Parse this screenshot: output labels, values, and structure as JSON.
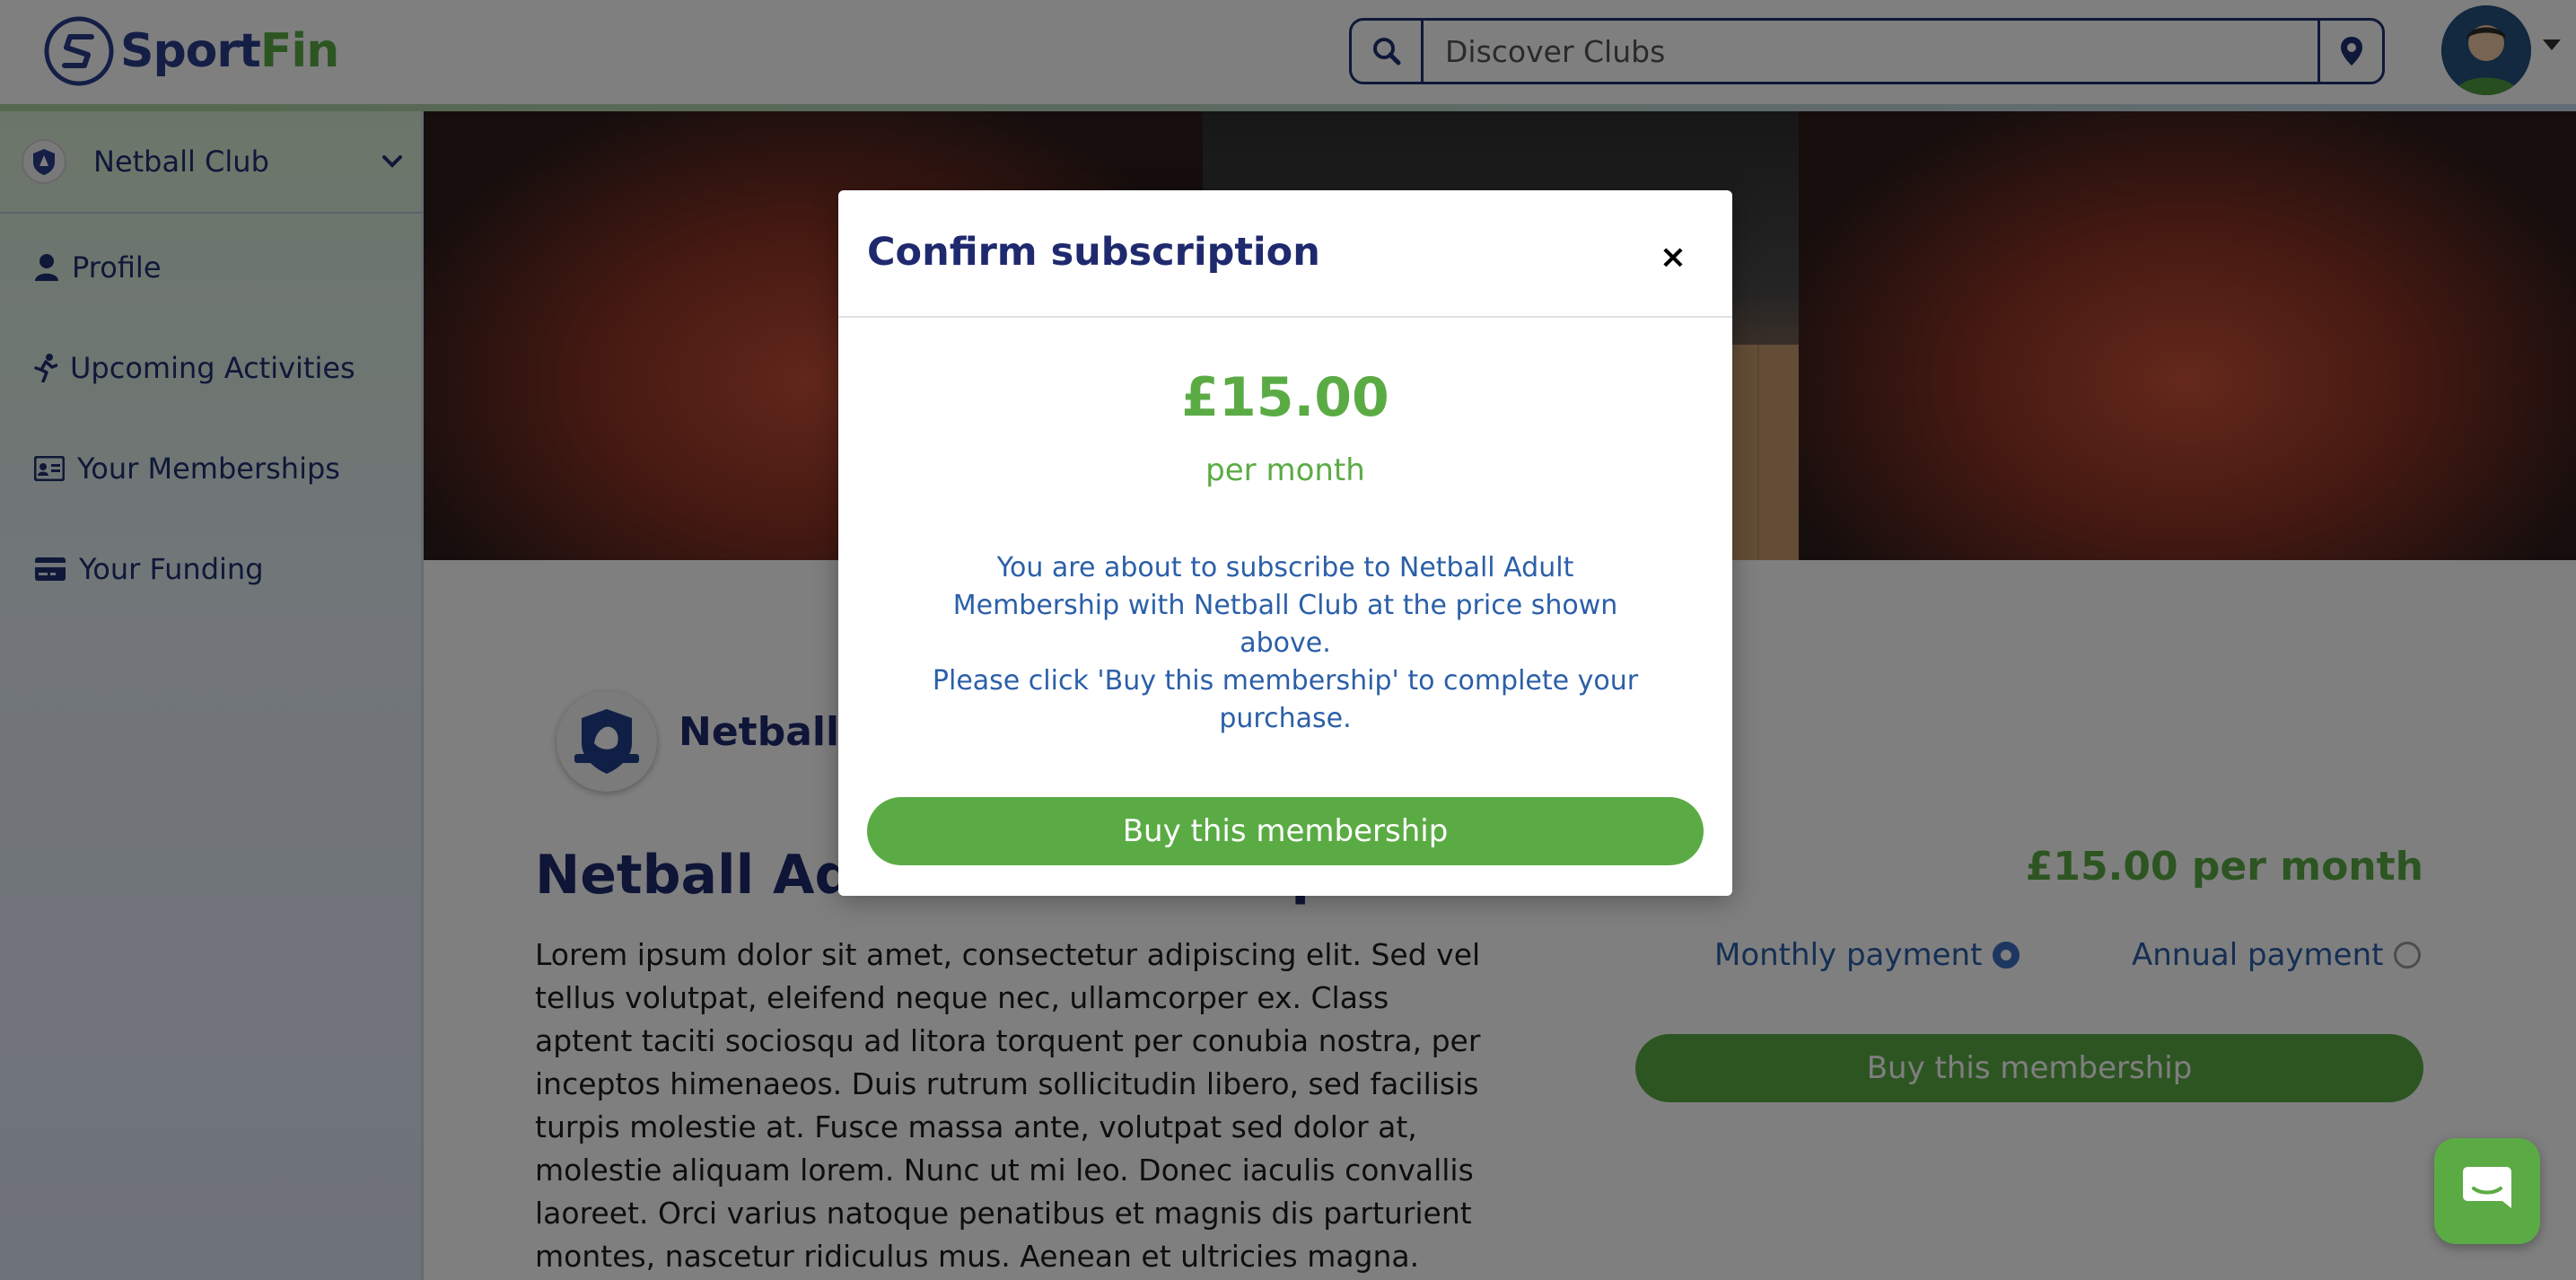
{
  "app": {
    "logo_sport": "Sport",
    "logo_fin": "Fin"
  },
  "search": {
    "placeholder": "Discover Clubs",
    "search_icon": "search-icon",
    "location_icon": "map-pin-icon"
  },
  "sidebar": {
    "club_select": {
      "label": "Netball Club",
      "icon": "chevron-down-icon"
    },
    "items": [
      {
        "label": "Profile",
        "icon": "user-icon"
      },
      {
        "label": "Upcoming Activities",
        "icon": "running-icon"
      },
      {
        "label": "Your Memberships",
        "icon": "id-card-icon"
      },
      {
        "label": "Your Funding",
        "icon": "credit-card-icon"
      }
    ]
  },
  "main": {
    "club_name": "Netball Club",
    "title": "Netball Adult Membership",
    "description": "Lorem ipsum dolor sit amet, consectetur adipiscing elit. Sed vel tellus volutpat, eleifend neque nec, ullamcorper ex. Class aptent taciti sociosqu ad litora torquent per conubia nostra, per inceptos himenaeos. Duis rutrum sollicitudin libero, sed facilisis turpis molestie at. Fusce massa ante, volutpat sed dolor at, molestie aliquam lorem. Nunc ut mi leo. Donec iaculis convallis laoreet. Orci varius natoque penatibus et magnis dis parturient montes, nascetur ridiculus mus. Aenean et ultricies magna. Mauris",
    "price_label": "£15.00 per month",
    "payment_options": [
      {
        "label": "Monthly payment",
        "selected": true
      },
      {
        "label": "Annual payment",
        "selected": false
      }
    ],
    "buy_label": "Buy this membership"
  },
  "modal": {
    "title": "Confirm subscription",
    "close_label": "×",
    "price": "£15.00",
    "period": "per month",
    "text_1": "You are about to subscribe to Netball Adult Membership with Netball Club at the price shown above.",
    "text_2": "Please click 'Buy this membership' to complete your purchase.",
    "buy_label": "Buy this membership"
  },
  "colors": {
    "brand_navy": "#1f2a6e",
    "brand_green": "#5bab45",
    "link_blue": "#2b5fa8"
  }
}
